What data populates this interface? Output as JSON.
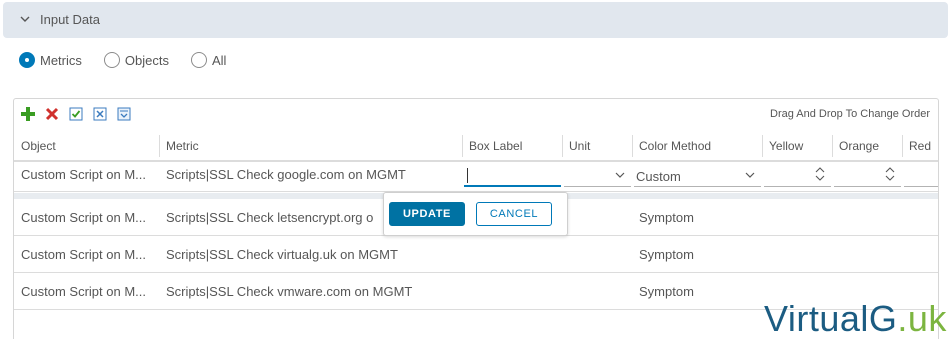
{
  "section": {
    "title": "Input Data",
    "icon": "chevron-down-icon"
  },
  "view_mode": {
    "options": [
      {
        "label": "Metrics",
        "selected": true
      },
      {
        "label": "Objects",
        "selected": false
      },
      {
        "label": "All",
        "selected": false
      }
    ]
  },
  "toolbar": {
    "icons": [
      "add-icon",
      "delete-icon",
      "select-all-icon",
      "deselect-all-icon",
      "move-to-bottom-icon"
    ],
    "hint": "Drag And Drop To Change Order"
  },
  "table": {
    "columns": [
      "Object",
      "Metric",
      "Box Label",
      "Unit",
      "Color Method",
      "Yellow",
      "Orange",
      "Red"
    ],
    "rows": [
      {
        "object": "Custom Script on M...",
        "metric": "Scripts|SSL Check google.com on MGMT",
        "box_label": "",
        "unit": "",
        "color_method": "Custom",
        "editing": true
      },
      {
        "object": "Custom Script on M...",
        "metric": "Scripts|SSL Check letsencrypt.org o",
        "box_label": "",
        "unit": "",
        "color_method": "Symptom",
        "editing": false
      },
      {
        "object": "Custom Script on M...",
        "metric": "Scripts|SSL Check virtualg.uk on MGMT",
        "box_label": "",
        "unit": "",
        "color_method": "Symptom",
        "editing": false
      },
      {
        "object": "Custom Script on M...",
        "metric": "Scripts|SSL Check vmware.com on MGMT",
        "box_label": "",
        "unit": "",
        "color_method": "Symptom",
        "editing": false
      }
    ]
  },
  "edit_popover": {
    "update_label": "UPDATE",
    "cancel_label": "CANCEL"
  },
  "watermark": {
    "part1": "VirtualG",
    "part2": ".uk"
  },
  "colors": {
    "accent": "#0079b8",
    "primary_button": "#0072a3",
    "header_bg": "#e1e7ee",
    "add_green": "#3a9d23",
    "delete_red": "#d0312d",
    "watermark_blue": "#1b5c82",
    "watermark_green": "#7cb540"
  }
}
